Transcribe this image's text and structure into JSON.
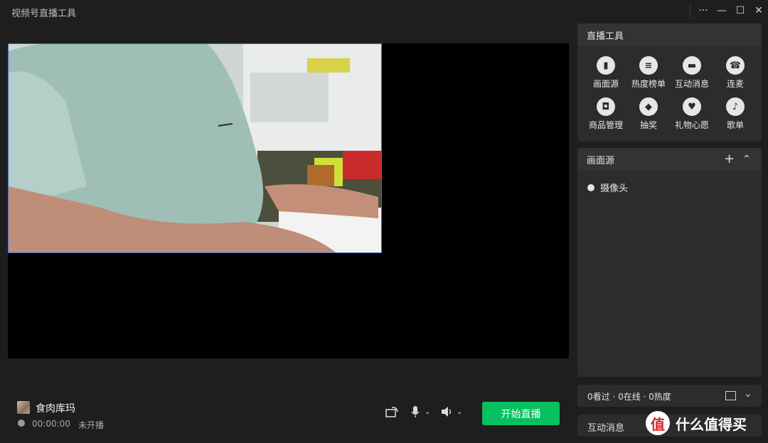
{
  "window": {
    "title": "视频号直播工具",
    "more_glyph": "···",
    "minimize_glyph": "—",
    "maximize_glyph": "☐",
    "close_glyph": "✕"
  },
  "anchor": {
    "name": "食肉库玛",
    "duration": "00:00:00",
    "status": "未开播"
  },
  "controls": {
    "start_label": "开始直播",
    "accent_color": "#07c160"
  },
  "tools_panel": {
    "title": "直播工具",
    "items": [
      {
        "label": "画面源",
        "icon": "screen-source-icon"
      },
      {
        "label": "热度榜单",
        "icon": "list-icon"
      },
      {
        "label": "互动消息",
        "icon": "chat-bubble-icon"
      },
      {
        "label": "连麦",
        "icon": "phone-icon"
      },
      {
        "label": "商品管理",
        "icon": "shopping-bag-icon"
      },
      {
        "label": "抽奖",
        "icon": "gift-box-icon"
      },
      {
        "label": "礼物心愿",
        "icon": "heart-icon"
      },
      {
        "label": "歌单",
        "icon": "microphone-icon"
      }
    ]
  },
  "source_panel": {
    "title": "画面源",
    "add_glyph": "+",
    "collapse_glyph": "⌃",
    "items": [
      {
        "label": "摄像头"
      }
    ]
  },
  "stats_bar": {
    "text": "0看过 · 0在线 · 0热度"
  },
  "message_bar": {
    "title": "互动消息"
  },
  "watermark": {
    "logo_text": "值",
    "text": "什么值得买"
  }
}
